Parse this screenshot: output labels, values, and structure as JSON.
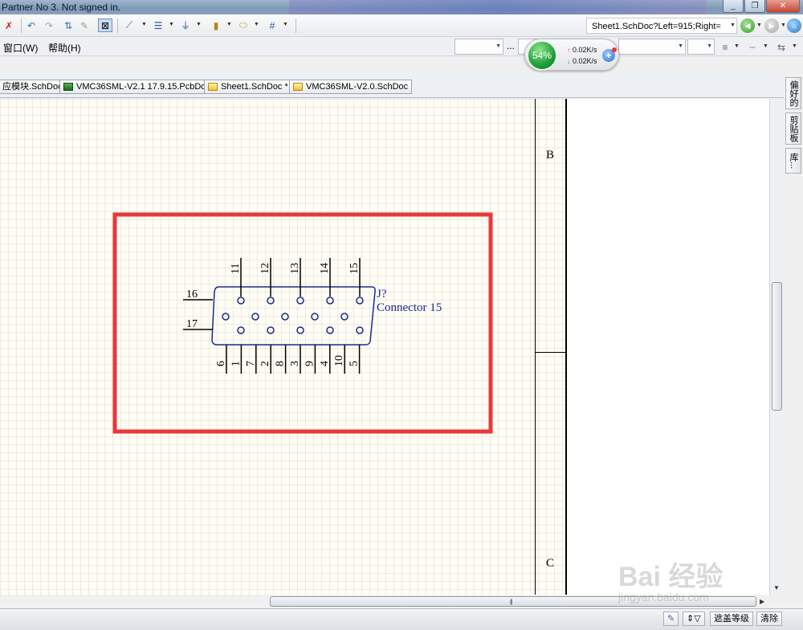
{
  "window": {
    "title": "Partner No 3. Not signed in."
  },
  "address_bar": {
    "value": "Sheet1.SchDoc?Left=915;Right="
  },
  "menu": {
    "items": [
      {
        "label": "窗口(W)"
      },
      {
        "label": "帮助(H)"
      }
    ],
    "ellipsis": "..."
  },
  "network_widget": {
    "percent": "54%",
    "upload": "0.02K/s",
    "download": "0.02K/s"
  },
  "tabs": [
    {
      "label": "应模块.SchDoc",
      "type": "sch"
    },
    {
      "label": "VMC36SML-V2.1 17.9.15.PcbDoc",
      "type": "pcb"
    },
    {
      "label": "Sheet1.SchDoc *",
      "type": "sch"
    },
    {
      "label": "VMC36SML-V2.0.SchDoc",
      "type": "sch"
    }
  ],
  "side_panels": [
    {
      "label": "偏好的"
    },
    {
      "label": "剪贴板"
    },
    {
      "label": "库..."
    }
  ],
  "schematic": {
    "zones": [
      "B",
      "C"
    ],
    "component": {
      "designator": "J?",
      "comment": "Connector 15",
      "top_pins": [
        "11",
        "12",
        "13",
        "14",
        "15"
      ],
      "left_pins": [
        "16",
        "17"
      ],
      "bottom_pins": [
        "6",
        "1",
        "7",
        "2",
        "8",
        "3",
        "9",
        "4",
        "10",
        "5"
      ]
    },
    "highlight_color": "#e8383a",
    "component_color": "#1a2a8c"
  },
  "status_bar": {
    "mask_level": "遮盖等级",
    "clear": "清除"
  },
  "watermark": {
    "text": "Bai 经验",
    "url": "jingyan.baidu.com"
  }
}
